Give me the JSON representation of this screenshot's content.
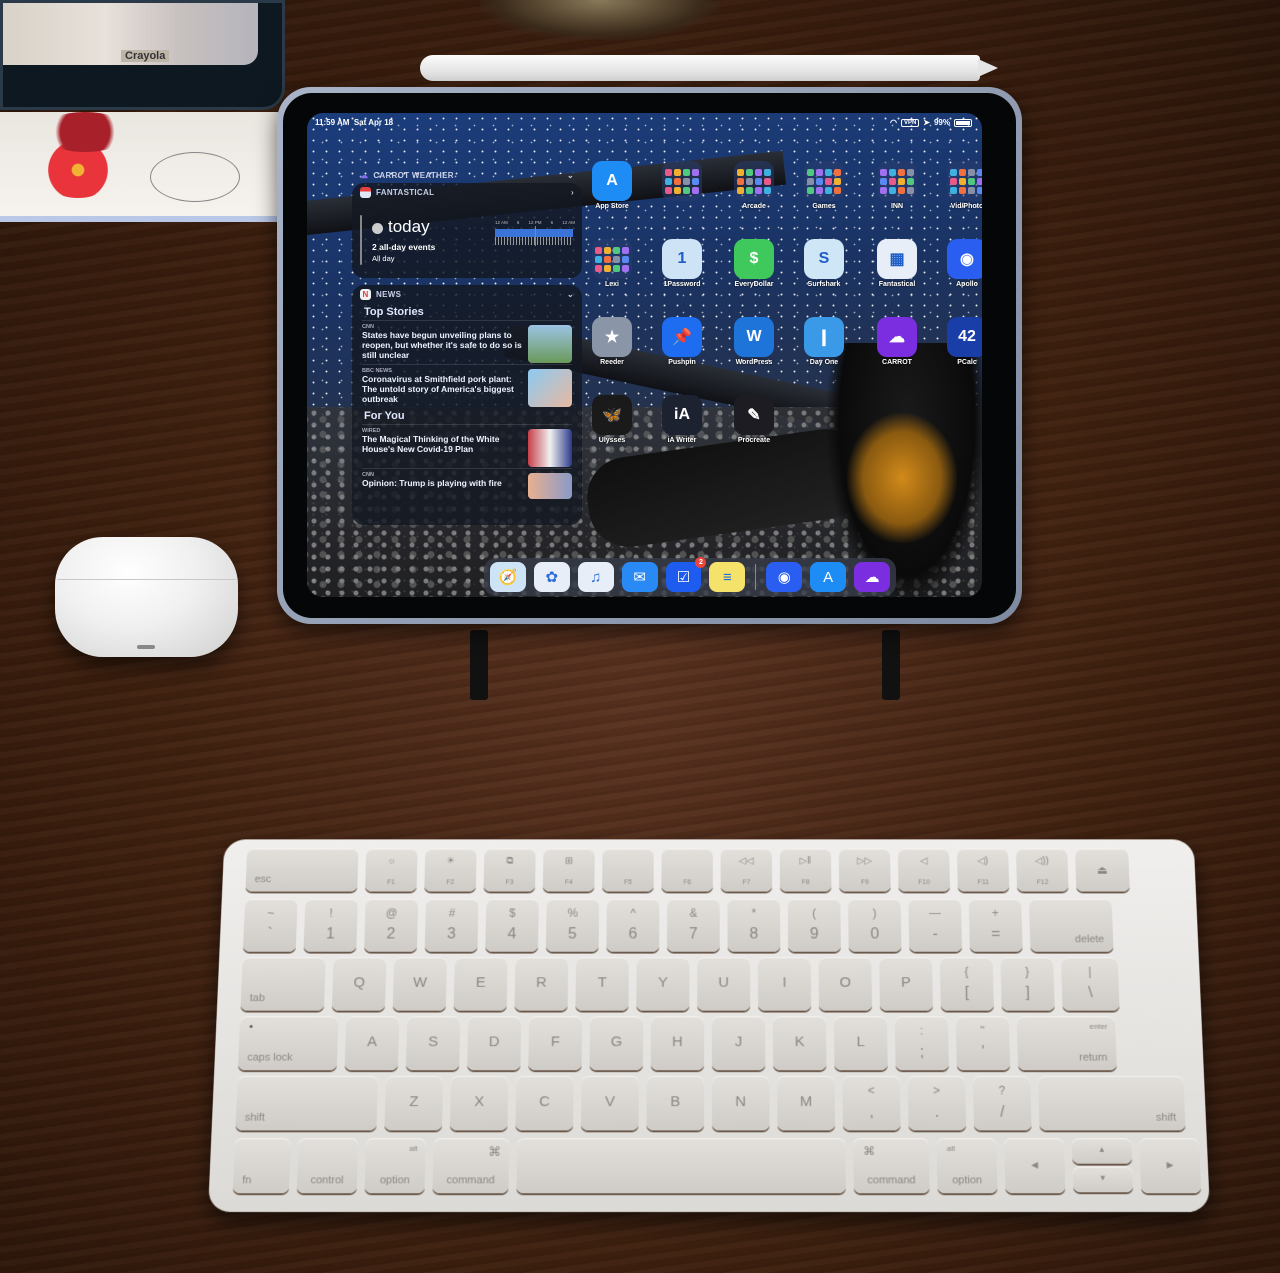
{
  "scene": {
    "description": "iPad Pro on a stand above a Magic Keyboard on a wooden desk",
    "props": {
      "tin_label": "Crayola",
      "airpods_case": "AirPods Pro case",
      "pencil": "Apple Pencil"
    }
  },
  "ipad": {
    "status_bar": {
      "time": "11:59 AM",
      "date": "Sat Apr 18",
      "battery": "99%",
      "icons": [
        "wifi-icon",
        "vpn-icon",
        "location-icon",
        "battery-icon"
      ]
    },
    "widgets": {
      "carrot_weather": {
        "title": "CARROT WEATHER"
      },
      "fantastical": {
        "title": "FANTASTICAL",
        "day": "today",
        "events": "2 all-day events",
        "events_detail": "All day",
        "timeline_labels": [
          "12 AM",
          "6",
          "12 PM",
          "6",
          "12 AM"
        ]
      },
      "news": {
        "title": "NEWS",
        "sections": [
          {
            "heading": "Top Stories",
            "stories": [
              {
                "source": "CNN",
                "headline": "States have begun unveiling plans to reopen, but whether it's safe to do so is still unclear",
                "thumb": "#7fa6c8"
              },
              {
                "source": "BBC NEWS",
                "headline": "Coronavirus at Smithfield pork plant: The untold story of America's biggest outbreak",
                "thumb": "#78b4e6"
              }
            ]
          },
          {
            "heading": "For You",
            "stories": [
              {
                "source": "WIRED",
                "headline": "The Magical Thinking of the White House's New Covid-19 Plan",
                "thumb": "#b85a6a"
              },
              {
                "source": "CNN",
                "headline": "Opinion: Trump is playing with fire",
                "thumb": "#8a9ab8"
              }
            ]
          }
        ]
      }
    },
    "home_screen": {
      "rows": [
        [
          {
            "label": "App Store",
            "icon": "app-store-icon",
            "color": "#1e8cf5",
            "glyph": "A"
          },
          {
            "label": "",
            "icon": "apple-folder-icon",
            "folder": true
          },
          {
            "label": "Arcade",
            "icon": "arcade-folder-icon",
            "folder": true
          },
          {
            "label": "Games",
            "icon": "games-folder-icon",
            "folder": true
          },
          {
            "label": "INN",
            "icon": "inn-folder-icon",
            "folder": true
          },
          {
            "label": "Vid/Photo",
            "icon": "vid-photo-folder-icon",
            "folder": true
          }
        ],
        [
          {
            "label": "Lexi",
            "icon": "lexi-folder-icon",
            "folder": true
          },
          {
            "label": "1Password",
            "icon": "1password-icon",
            "color": "#cfe3f7",
            "glyph": "1"
          },
          {
            "label": "EveryDollar",
            "icon": "everydollar-icon",
            "color": "#3fc85c",
            "glyph": "$"
          },
          {
            "label": "Surfshark",
            "icon": "surfshark-icon",
            "color": "#cfe6f7",
            "glyph": "S"
          },
          {
            "label": "Fantastical",
            "icon": "fantastical-icon",
            "color": "#e8eef7",
            "glyph": "▦"
          },
          {
            "label": "Apollo",
            "icon": "apollo-icon",
            "color": "#2a5ef0",
            "glyph": "◉"
          }
        ],
        [
          {
            "label": "Reeder",
            "icon": "reeder-icon",
            "color": "#8a95a8",
            "glyph": "★"
          },
          {
            "label": "Pushpin",
            "icon": "pushpin-icon",
            "color": "#1e6cf0",
            "glyph": "📌"
          },
          {
            "label": "WordPress",
            "icon": "wordpress-icon",
            "color": "#1e74d8",
            "glyph": "W"
          },
          {
            "label": "Day One",
            "icon": "day-one-icon",
            "color": "#3a9ae8",
            "glyph": "❙"
          },
          {
            "label": "CARROT",
            "icon": "carrot-weather-icon",
            "color": "#7a2ee0",
            "glyph": "☁"
          },
          {
            "label": "PCalc",
            "icon": "pcalc-icon",
            "color": "#1a3ea8",
            "glyph": "42"
          }
        ],
        [
          {
            "label": "Ulysses",
            "icon": "ulysses-icon",
            "color": "#1a1a1a",
            "glyph": "🦋"
          },
          {
            "label": "iA Writer",
            "icon": "ia-writer-icon",
            "color": "#1c2230",
            "glyph": "iA"
          },
          {
            "label": "Procreate",
            "icon": "procreate-icon",
            "color": "#1c1c22",
            "glyph": "✎"
          }
        ]
      ],
      "dock": [
        {
          "name": "Safari",
          "icon": "safari-icon",
          "color": "#cfe3f7",
          "glyph": "🧭"
        },
        {
          "name": "Photos",
          "icon": "photos-icon",
          "color": "#e8eef7",
          "glyph": "✿"
        },
        {
          "name": "Music",
          "icon": "music-icon",
          "color": "#e8eef7",
          "glyph": "♫"
        },
        {
          "name": "Mail",
          "icon": "mail-icon",
          "color": "#2a8af5",
          "glyph": "✉"
        },
        {
          "name": "Things",
          "icon": "things-icon",
          "color": "#1e5cf0",
          "glyph": "☑",
          "badge": "2"
        },
        {
          "name": "Notes",
          "icon": "notes-icon",
          "color": "#f5e26a",
          "glyph": "≡"
        },
        {
          "name": "Apollo",
          "icon": "apollo-icon",
          "color": "#2a5ef0",
          "glyph": "◉",
          "recent": true
        },
        {
          "name": "App Store",
          "icon": "app-store-icon",
          "color": "#1e8cf5",
          "glyph": "A",
          "recent": true
        },
        {
          "name": "CARROT Weather",
          "icon": "carrot-weather-icon",
          "color": "#7a2ee0",
          "glyph": "☁",
          "recent": true
        }
      ]
    }
  },
  "keyboard": {
    "fn_row": [
      {
        "label": "esc"
      },
      {
        "fn": "F1",
        "icon": "☼"
      },
      {
        "fn": "F2",
        "icon": "☀"
      },
      {
        "fn": "F3",
        "icon": "⧉"
      },
      {
        "fn": "F4",
        "icon": "⊞"
      },
      {
        "fn": "F5",
        "icon": ""
      },
      {
        "fn": "F6",
        "icon": ""
      },
      {
        "fn": "F7",
        "icon": "◁◁"
      },
      {
        "fn": "F8",
        "icon": "▷ǁ"
      },
      {
        "fn": "F9",
        "icon": "▷▷"
      },
      {
        "fn": "F10",
        "icon": "◁"
      },
      {
        "fn": "F11",
        "icon": "◁)"
      },
      {
        "fn": "F12",
        "icon": "◁))"
      },
      {
        "label": "⏏"
      }
    ],
    "number_row": [
      {
        "top": "~",
        "main": "`"
      },
      {
        "top": "!",
        "main": "1"
      },
      {
        "top": "@",
        "main": "2"
      },
      {
        "top": "#",
        "main": "3"
      },
      {
        "top": "$",
        "main": "4"
      },
      {
        "top": "%",
        "main": "5"
      },
      {
        "top": "^",
        "main": "6"
      },
      {
        "top": "&",
        "main": "7"
      },
      {
        "top": "*",
        "main": "8"
      },
      {
        "top": "(",
        "main": "9"
      },
      {
        "top": ")",
        "main": "0"
      },
      {
        "top": "—",
        "main": "-"
      },
      {
        "top": "+",
        "main": "="
      },
      {
        "label": "delete"
      }
    ],
    "top_row": [
      "tab",
      "Q",
      "W",
      "E",
      "R",
      "T",
      "Y",
      "U",
      "I",
      "O",
      "P",
      "{ [",
      "} ]",
      "| \\"
    ],
    "home_row": [
      "caps lock",
      "A",
      "S",
      "D",
      "F",
      "G",
      "H",
      "J",
      "K",
      "L",
      ": ;",
      "\" '",
      "return"
    ],
    "home_row_return_alt": "enter",
    "bottom_row": [
      "shift",
      "Z",
      "X",
      "C",
      "V",
      "B",
      "N",
      "M",
      "< ,",
      "> .",
      "? /",
      "shift"
    ],
    "modifier_row": {
      "fn": "fn",
      "control": "control",
      "option_left": {
        "top": "alt",
        "label": "option"
      },
      "command_left": {
        "top": "⌘",
        "label": "command"
      },
      "command_right": {
        "top": "⌘",
        "label": "command"
      },
      "option_right": {
        "top": "alt",
        "label": "option"
      },
      "arrows": {
        "left": "◀",
        "up": "▲",
        "down": "▼",
        "right": "▶"
      }
    }
  }
}
